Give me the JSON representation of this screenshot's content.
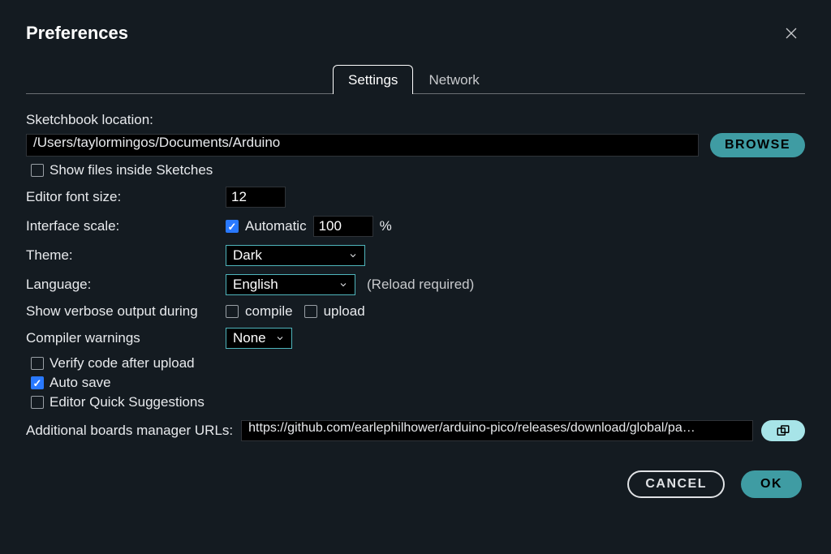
{
  "window": {
    "title": "Preferences"
  },
  "tabs": {
    "settings": "Settings",
    "network": "Network"
  },
  "form": {
    "sketchbook_label": "Sketchbook location:",
    "sketchbook_value": "/Users/taylormingos/Documents/Arduino",
    "browse_label": "BROWSE",
    "show_files_label": "Show files inside Sketches",
    "show_files_checked": false,
    "font_size_label": "Editor font size:",
    "font_size_value": "12",
    "iface_scale_label": "Interface scale:",
    "iface_auto_label": "Automatic",
    "iface_auto_checked": true,
    "iface_scale_value": "100",
    "iface_scale_suffix": "%",
    "theme_label": "Theme:",
    "theme_value": "Dark",
    "language_label": "Language:",
    "language_value": "English",
    "language_hint": "(Reload required)",
    "verbose_label": "Show verbose output during",
    "verbose_compile_label": "compile",
    "verbose_compile_checked": false,
    "verbose_upload_label": "upload",
    "verbose_upload_checked": false,
    "compiler_warnings_label": "Compiler warnings",
    "compiler_warnings_value": "None",
    "verify_upload_label": "Verify code after upload",
    "verify_upload_checked": false,
    "autosave_label": "Auto save",
    "autosave_checked": true,
    "quick_suggest_label": "Editor Quick Suggestions",
    "quick_suggest_checked": false,
    "boards_urls_label": "Additional boards manager URLs:",
    "boards_urls_value": "https://github.com/earlephilhower/arduino-pico/releases/download/global/pa…"
  },
  "footer": {
    "cancel": "CANCEL",
    "ok": "OK"
  }
}
